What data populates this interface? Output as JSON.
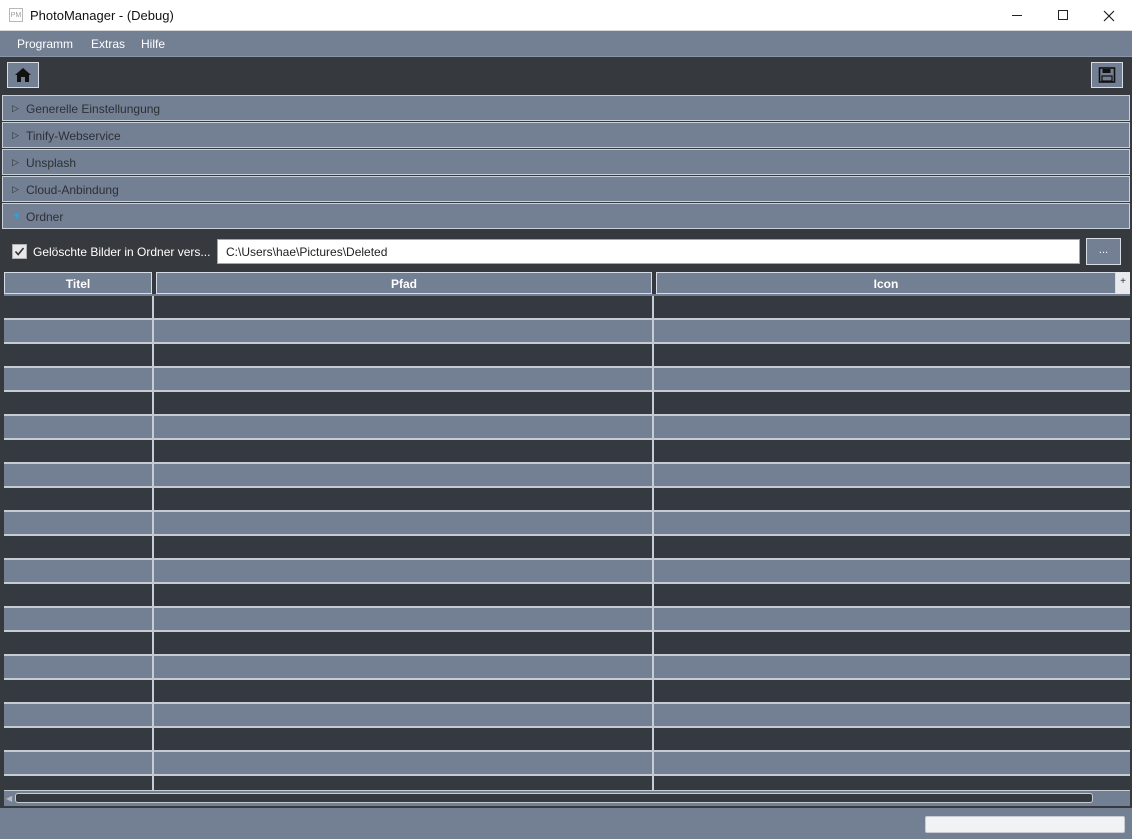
{
  "window": {
    "title": "PhotoManager - (Debug)",
    "icon_text": "PM",
    "controls": {
      "minimize": "minimize-icon",
      "maximize": "maximize-icon",
      "close": "close-icon"
    }
  },
  "menu": {
    "items": [
      {
        "label": "Programm"
      },
      {
        "label": "Extras"
      },
      {
        "label": "Hilfe"
      }
    ]
  },
  "toolbar": {
    "home_icon": "home-icon",
    "save_icon": "save-icon"
  },
  "expanders": [
    {
      "label": "Generelle Einstellungung",
      "expanded": false
    },
    {
      "label": "Tinify-Webservice",
      "expanded": false
    },
    {
      "label": "Unsplash",
      "expanded": false
    },
    {
      "label": "Cloud-Anbindung",
      "expanded": false
    },
    {
      "label": "Ordner",
      "expanded": true
    }
  ],
  "folder": {
    "checkbox_checked": true,
    "checkbox_label": "Gelöschte Bilder in Ordner vers...",
    "path_value": "C:\\Users\\hae\\Pictures\\Deleted",
    "browse_label": "..."
  },
  "grid": {
    "columns": [
      {
        "label": "Titel"
      },
      {
        "label": "Pfad"
      },
      {
        "label": "Icon"
      }
    ],
    "header_button": "+",
    "rows": []
  },
  "status": {
    "progress": 0
  },
  "colors": {
    "accent": "#2aa5d5",
    "panel": "#737f93",
    "dark": "#36393e"
  }
}
